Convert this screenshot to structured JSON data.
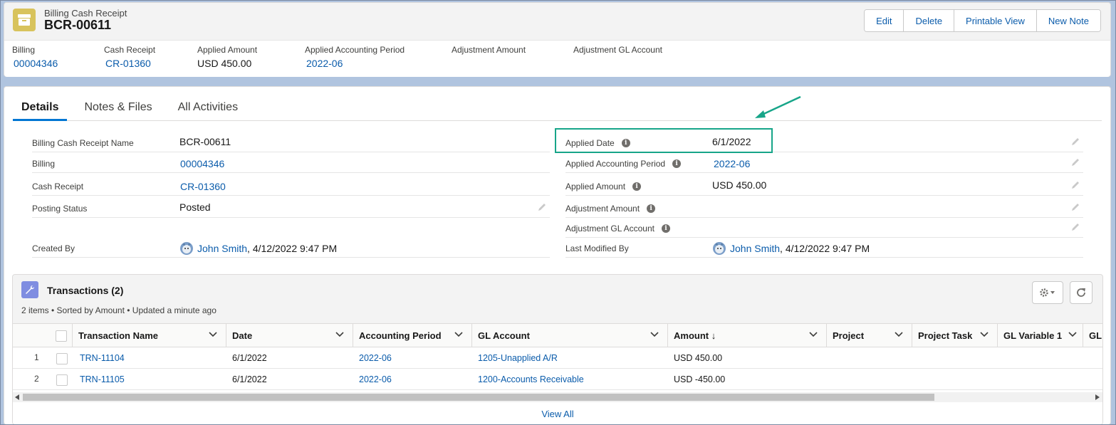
{
  "header": {
    "object_type": "Billing Cash Receipt",
    "record_name": "BCR-00611",
    "buttons": [
      "Edit",
      "Delete",
      "Printable View",
      "New Note"
    ]
  },
  "highlights": [
    {
      "label": "Billing",
      "value": "00004346",
      "link": true
    },
    {
      "label": "Cash Receipt",
      "value": "CR-01360",
      "link": true
    },
    {
      "label": "Applied Amount",
      "value": "USD 450.00",
      "link": false
    },
    {
      "label": "Applied Accounting Period",
      "value": "2022-06",
      "link": true
    },
    {
      "label": "Adjustment Amount",
      "value": "",
      "link": false
    },
    {
      "label": "Adjustment GL Account",
      "value": "",
      "link": false
    }
  ],
  "tabs": [
    "Details",
    "Notes & Files",
    "All Activities"
  ],
  "details_left": [
    {
      "label": "Billing Cash Receipt Name",
      "value": "BCR-00611"
    },
    {
      "label": "Billing",
      "value": "00004346"
    },
    {
      "label": "Cash Receipt",
      "value": "CR-01360"
    },
    {
      "label": "Posting Status",
      "value": "Posted"
    },
    {
      "label": "Created By",
      "user": "John Smith",
      "date": ", 4/12/2022 9:47 PM"
    }
  ],
  "details_right": [
    {
      "label": "Applied Date",
      "value": "6/1/2022"
    },
    {
      "label": "Applied Accounting Period",
      "value": "2022-06"
    },
    {
      "label": "Applied Amount",
      "value": "USD 450.00"
    },
    {
      "label": "Adjustment Amount",
      "value": ""
    },
    {
      "label": "Adjustment GL Account",
      "value": ""
    },
    {
      "label": "Last Modified By",
      "user": "John Smith",
      "date": ", 4/12/2022 9:47 PM"
    }
  ],
  "related": {
    "title": "Transactions (2)",
    "subtitle": "2 items • Sorted by Amount • Updated a minute ago",
    "columns": [
      "Transaction Name",
      "Date",
      "Accounting Period",
      "GL Account",
      "Amount ↓",
      "Project",
      "Project Task",
      "GL Variable 1",
      "GL"
    ],
    "rows": [
      {
        "num": "1",
        "name": "TRN-11104",
        "date": "6/1/2022",
        "period": "2022-06",
        "gl": "1205-Unapplied A/R",
        "amount": "USD 450.00"
      },
      {
        "num": "2",
        "name": "TRN-11105",
        "date": "6/1/2022",
        "period": "2022-06",
        "gl": "1200-Accounts Receivable",
        "amount": "USD -450.00"
      }
    ],
    "view_all": "View All"
  },
  "colors": {
    "accent": "#0176d3",
    "link": "#0b5cab",
    "highlight_box": "#17a589"
  }
}
